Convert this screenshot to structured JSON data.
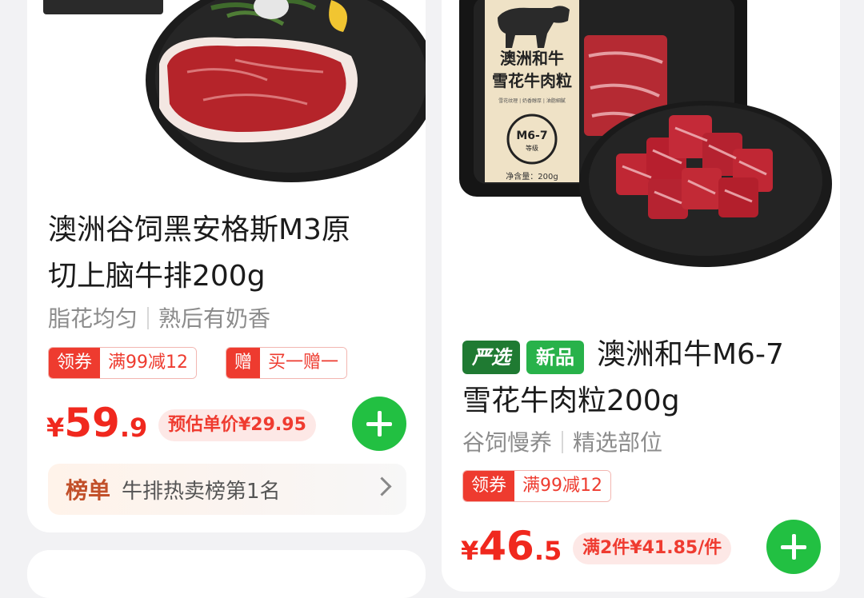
{
  "products": [
    {
      "title_line1": "澳洲谷饲黑安格斯M3原",
      "title_line2": "切上脑牛排200g",
      "tag1": "脂花均匀",
      "tag2": "熟后有奶香",
      "coupon1_tag": "领券",
      "coupon1_text": "满99减12",
      "coupon2_tag": "赠",
      "coupon2_text": "买一赠一",
      "price_symbol": "¥",
      "price_int": "59",
      "price_dec": ".9",
      "estimate": "预估单价¥29.95",
      "rank_badge": "榜单",
      "rank_text": "牛排热卖榜第1名"
    },
    {
      "label1": "严选",
      "label2": "新品",
      "title_line1": "澳洲和牛M6-7",
      "title_line2": "雪花牛肉粒200g",
      "tag1": "谷饲慢养",
      "tag2": "精选部位",
      "coupon1_tag": "领券",
      "coupon1_text": "满99减12",
      "price_symbol": "¥",
      "price_int": "46",
      "price_dec": ".5",
      "estimate": "满2件¥41.85/件",
      "package_title1": "澳洲和牛",
      "package_title2": "雪花牛肉粒",
      "package_grade": "M6-7",
      "package_grade_sub": "等级",
      "package_net": "净含量：200g",
      "package_features": "雪花纹理 | 奶香醇厚 | 油脂細膩"
    }
  ]
}
